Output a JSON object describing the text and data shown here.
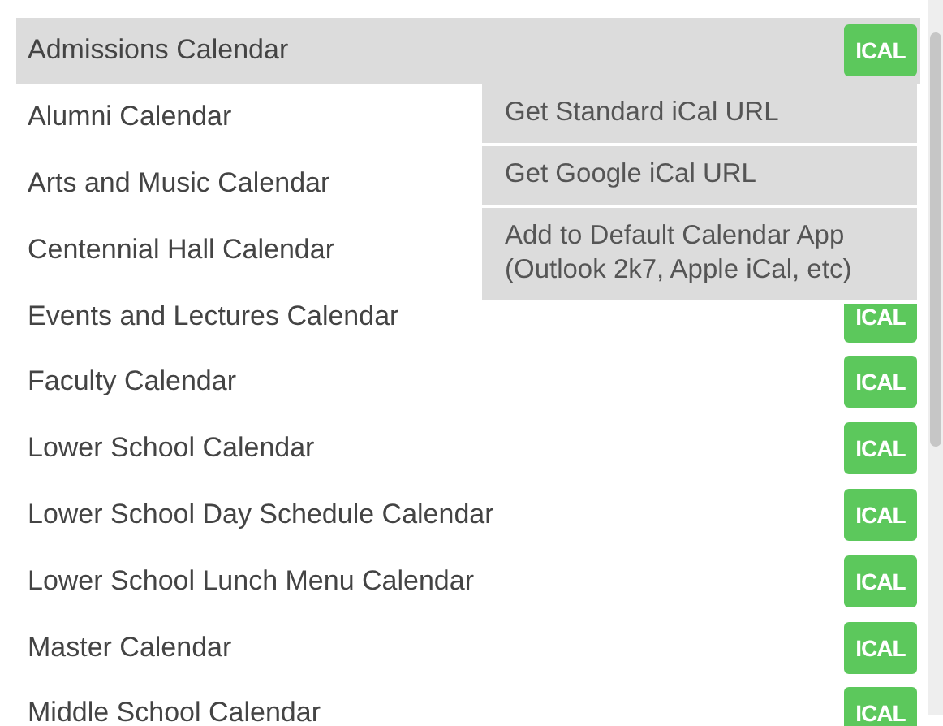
{
  "calendars": [
    {
      "name": "Admissions Calendar",
      "selected": true,
      "ical": "ICAL"
    },
    {
      "name": "Alumni Calendar",
      "selected": false
    },
    {
      "name": "Arts and Music Calendar",
      "selected": false
    },
    {
      "name": "Centennial Hall Calendar",
      "selected": false
    },
    {
      "name": "Events and Lectures Calendar",
      "selected": false,
      "ical": "ICAL"
    },
    {
      "name": "Faculty Calendar",
      "selected": false,
      "ical": "ICAL"
    },
    {
      "name": "Lower School Calendar",
      "selected": false,
      "ical": "ICAL"
    },
    {
      "name": "Lower School Day Schedule Calendar",
      "selected": false,
      "ical": "ICAL"
    },
    {
      "name": "Lower School Lunch Menu Calendar",
      "selected": false,
      "ical": "ICAL"
    },
    {
      "name": "Master Calendar",
      "selected": false,
      "ical": "ICAL"
    },
    {
      "name": "Middle School Calendar",
      "selected": false,
      "ical": "ICAL"
    }
  ],
  "ical_menu": [
    "Get Standard iCal URL",
    "Get Google iCal URL",
    "Add to Default Calendar App\n(Outlook 2k7, Apple iCal, etc)"
  ]
}
